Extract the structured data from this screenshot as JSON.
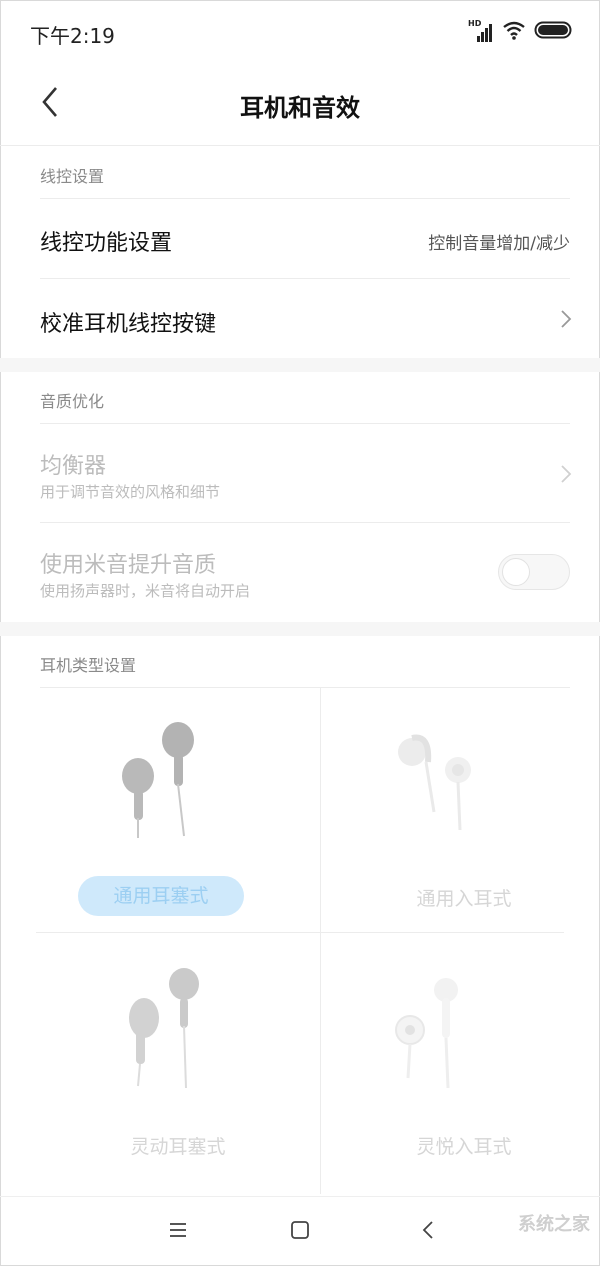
{
  "status_bar": {
    "time": "下午2:19",
    "signal_badge": "HD",
    "icons": [
      "signal-icon",
      "wifi-icon",
      "battery-icon"
    ]
  },
  "header": {
    "title": "耳机和音效",
    "back_icon": "chevron-left-icon"
  },
  "sections": {
    "wire_control": {
      "label": "线控设置",
      "rows": [
        {
          "title": "线控功能设置",
          "value": "控制音量增加/减少"
        },
        {
          "title": "校准耳机线控按键"
        }
      ]
    },
    "sound_quality": {
      "label": "音质优化",
      "rows": [
        {
          "title": "均衡器",
          "subtitle": "用于调节音效的风格和细节"
        },
        {
          "title": "使用米音提升音质",
          "subtitle": "使用扬声器时，米音将自动开启",
          "toggle_on": false
        }
      ]
    },
    "earphone_type": {
      "label": "耳机类型设置",
      "options": [
        {
          "label": "通用耳塞式",
          "selected": true
        },
        {
          "label": "通用入耳式",
          "selected": false
        },
        {
          "label": "灵动耳塞式",
          "selected": false
        },
        {
          "label": "灵悦入耳式",
          "selected": false
        }
      ]
    }
  },
  "nav_bar": {
    "icons": [
      "menu-icon",
      "home-icon",
      "back-icon"
    ]
  },
  "watermark": "系统之家",
  "colors": {
    "accent": "#cfe9fb",
    "accent_text": "#9ccff2",
    "divider": "#ececec"
  }
}
